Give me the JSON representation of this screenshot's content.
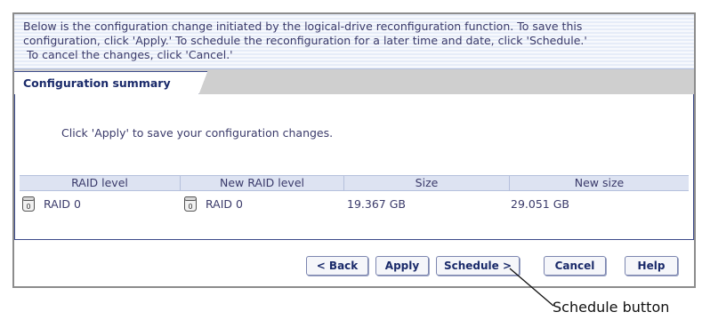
{
  "info": {
    "line1": "Below is the configuration change initiated by the logical-drive reconfiguration function.  To save this",
    "line2": "configuration, click 'Apply.'  To schedule the reconfiguration for a later time and date, click 'Schedule.'",
    "line3": " To cancel the changes, click 'Cancel.'"
  },
  "tab": {
    "label": "Configuration summary"
  },
  "instruction": "Click 'Apply' to save your configuration changes.",
  "table": {
    "headers": [
      "RAID level",
      "New RAID level",
      "Size",
      "New size"
    ],
    "rows": [
      {
        "raid_level": "RAID 0",
        "new_raid_level": "RAID 0",
        "size": "19.367 GB",
        "new_size": "29.051 GB"
      }
    ]
  },
  "buttons": {
    "back": "< Back",
    "apply": "Apply",
    "schedule": "Schedule >",
    "cancel": "Cancel",
    "help": "Help"
  },
  "callout": "Schedule button",
  "icons": {
    "disk": "disk-drive-icon"
  },
  "colors": {
    "text": "#3a3a6a",
    "accent": "#1a2a6a",
    "header_bg": "#dde3f2"
  }
}
